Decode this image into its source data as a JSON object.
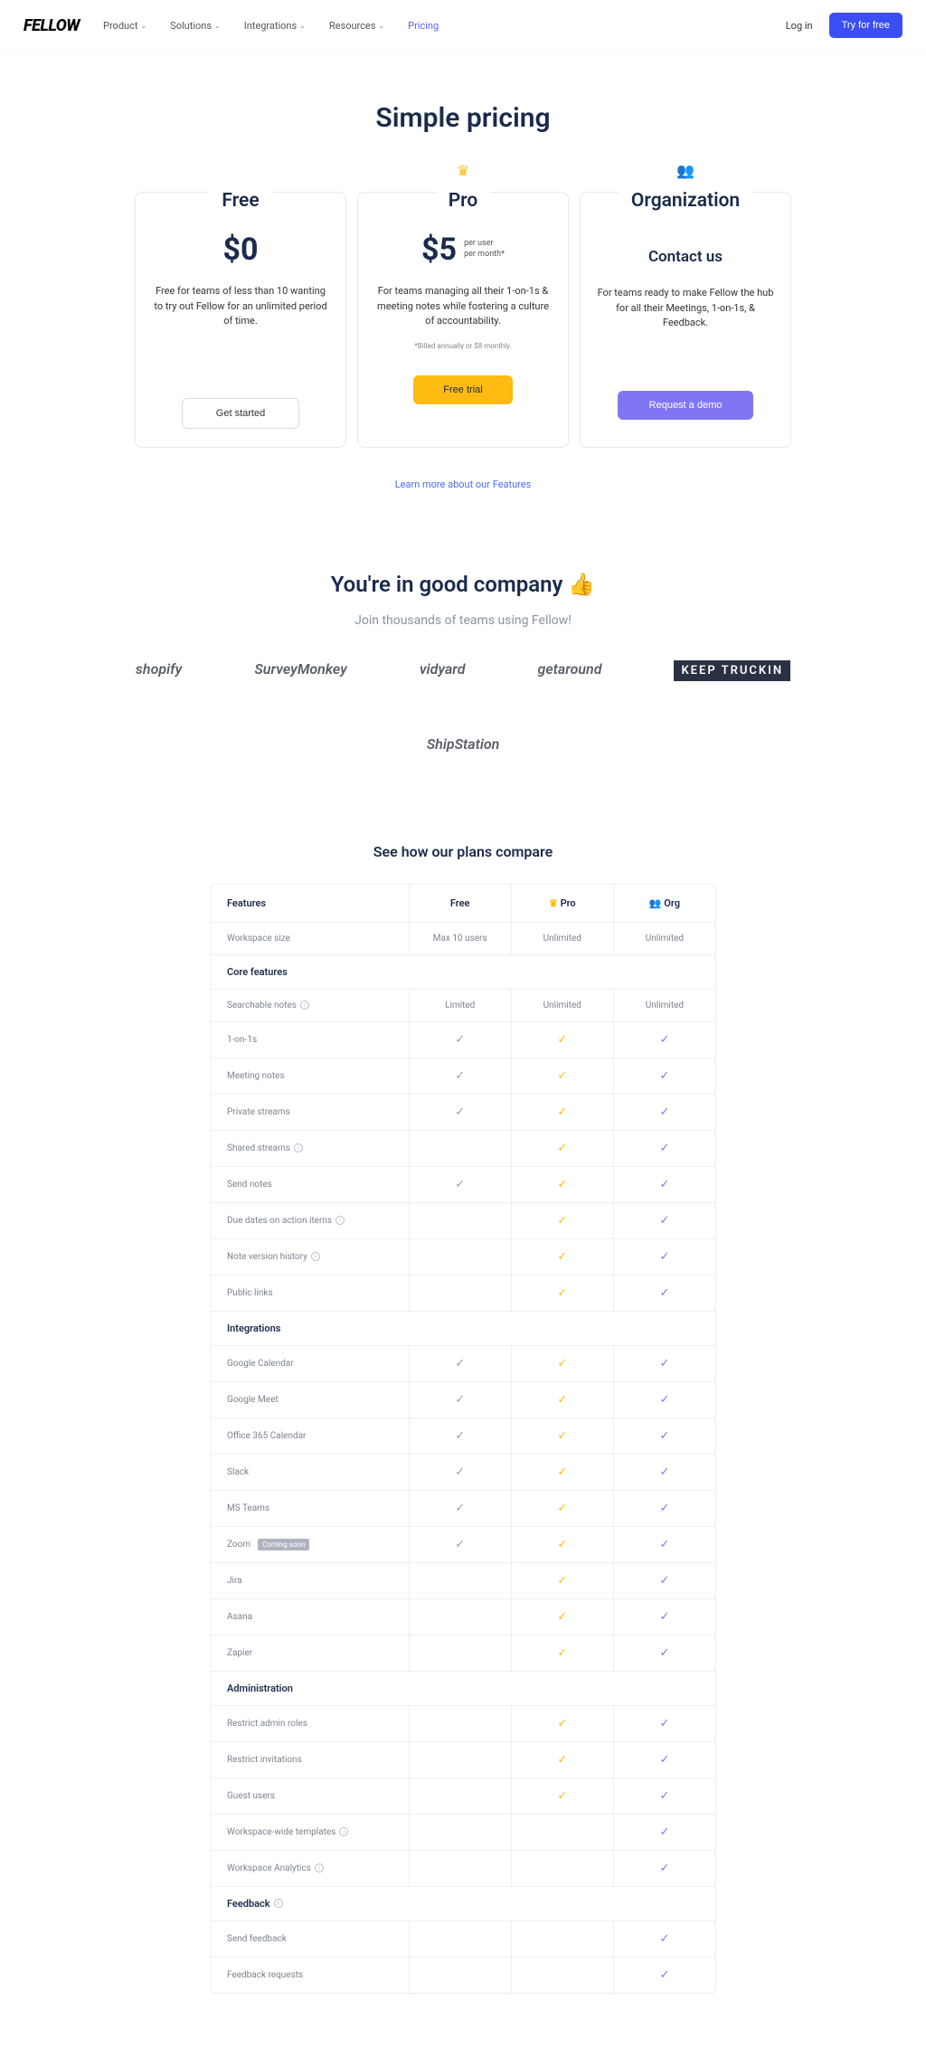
{
  "nav": {
    "logo": "FELLOW",
    "links": [
      "Product",
      "Solutions",
      "Integrations",
      "Resources",
      "Pricing"
    ],
    "login": "Log in",
    "try": "Try for free"
  },
  "hero": {
    "title": "Simple pricing"
  },
  "plans": [
    {
      "name": "Free",
      "price": "$0",
      "per_a": "",
      "per_b": "",
      "desc": "Free for teams of less than 10 wanting to try out Fellow for an unlimited period of time.",
      "note": "",
      "cta": "Get started",
      "badge": ""
    },
    {
      "name": "Pro",
      "price": "$5",
      "per_a": "per user",
      "per_b": "per month*",
      "desc": "For teams managing all their 1-on-1s & meeting notes while fostering a culture of accountability.",
      "note": "*Billed annually or $8 monthly.",
      "cta": "Free trial",
      "badge": "crown"
    },
    {
      "name": "Organization",
      "price": "",
      "per_a": "",
      "per_b": "",
      "contact": "Contact us",
      "desc": "For teams ready to make Fellow the hub for all their Meetings, 1-on-1s, & Feedback.",
      "note": "",
      "cta": "Request a demo",
      "badge": "people"
    }
  ],
  "learn_more": "Learn more about our Features",
  "company": {
    "title": "You're in good company 👍",
    "sub": "Join thousands of teams using Fellow!",
    "logos": [
      "shopify",
      "SurveyMonkey",
      "vidyard",
      "getaround",
      "KEEP TRUCKIN",
      "ShipStation"
    ]
  },
  "compare": {
    "title": "See how our plans compare",
    "header": {
      "features": "Features",
      "free": "Free",
      "pro": "Pro",
      "org": "Org"
    },
    "workspace": {
      "label": "Workspace size",
      "free": "Max 10 users",
      "pro": "Unlimited",
      "org": "Unlimited"
    },
    "sections": [
      {
        "title": "Core features",
        "info": false,
        "rows": [
          {
            "label": "Searchable notes",
            "info": true,
            "free": "Limited",
            "pro": "Unlimited",
            "org": "Unlimited"
          },
          {
            "label": "1-on-1s",
            "info": false,
            "free": "check",
            "pro": "check",
            "org": "check"
          },
          {
            "label": "Meeting notes",
            "info": false,
            "free": "check",
            "pro": "check",
            "org": "check"
          },
          {
            "label": "Private streams",
            "info": false,
            "free": "check",
            "pro": "check",
            "org": "check"
          },
          {
            "label": "Shared streams",
            "info": true,
            "free": "",
            "pro": "check",
            "org": "check"
          },
          {
            "label": "Send notes",
            "info": false,
            "free": "check",
            "pro": "check",
            "org": "check"
          },
          {
            "label": "Due dates on action items",
            "info": true,
            "free": "",
            "pro": "check",
            "org": "check"
          },
          {
            "label": "Note version history",
            "info": true,
            "free": "",
            "pro": "check",
            "org": "check"
          },
          {
            "label": "Public links",
            "info": false,
            "free": "",
            "pro": "check",
            "org": "check"
          }
        ]
      },
      {
        "title": "Integrations",
        "info": false,
        "rows": [
          {
            "label": "Google Calendar",
            "info": false,
            "free": "check",
            "pro": "check",
            "org": "check"
          },
          {
            "label": "Google Meet",
            "info": false,
            "free": "check",
            "pro": "check",
            "org": "check"
          },
          {
            "label": "Office 365 Calendar",
            "info": false,
            "free": "check",
            "pro": "check",
            "org": "check"
          },
          {
            "label": "Slack",
            "info": false,
            "free": "check",
            "pro": "check",
            "org": "check"
          },
          {
            "label": "MS Teams",
            "info": false,
            "free": "check",
            "pro": "check",
            "org": "check"
          },
          {
            "label": "Zoom",
            "info": false,
            "soon": "Coming soon",
            "free": "check",
            "pro": "check",
            "org": "check"
          },
          {
            "label": "Jira",
            "info": false,
            "free": "",
            "pro": "check",
            "org": "check"
          },
          {
            "label": "Asana",
            "info": false,
            "free": "",
            "pro": "check",
            "org": "check"
          },
          {
            "label": "Zapier",
            "info": false,
            "free": "",
            "pro": "check",
            "org": "check"
          }
        ]
      },
      {
        "title": "Administration",
        "info": false,
        "rows": [
          {
            "label": "Restrict admin roles",
            "info": false,
            "free": "",
            "pro": "check",
            "org": "check"
          },
          {
            "label": "Restrict invitations",
            "info": false,
            "free": "",
            "pro": "check",
            "org": "check"
          },
          {
            "label": "Guest users",
            "info": false,
            "free": "",
            "pro": "check",
            "org": "check"
          },
          {
            "label": "Workspace-wide templates",
            "info": true,
            "free": "",
            "pro": "",
            "org": "check"
          },
          {
            "label": "Workspace Analytics",
            "info": true,
            "free": "",
            "pro": "",
            "org": "check"
          }
        ]
      },
      {
        "title": "Feedback",
        "info": true,
        "rows": [
          {
            "label": "Send feedback",
            "info": false,
            "free": "",
            "pro": "",
            "org": "check"
          },
          {
            "label": "Feedback requests",
            "info": false,
            "free": "",
            "pro": "",
            "org": "check"
          }
        ]
      }
    ]
  }
}
